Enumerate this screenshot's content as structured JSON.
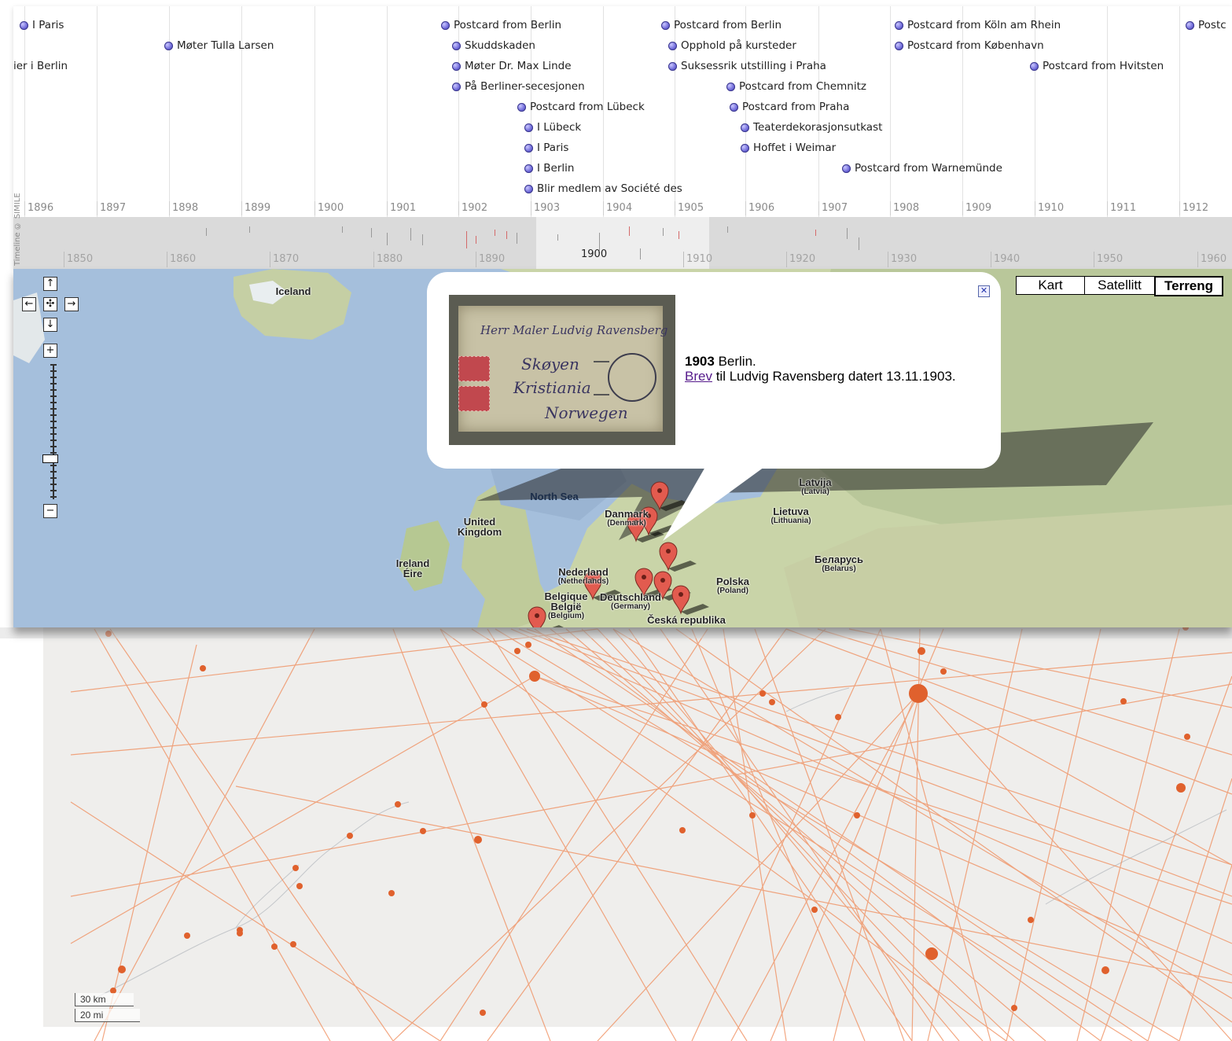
{
  "timeline": {
    "credit": "Timeline © SIMILE",
    "years": [
      "1896",
      "1897",
      "1898",
      "1899",
      "1900",
      "1901",
      "1902",
      "1903",
      "1904",
      "1905",
      "1906",
      "1907",
      "1908",
      "1909",
      "1910",
      "1911",
      "1912"
    ],
    "decades": [
      "1850",
      "1860",
      "1870",
      "1880",
      "1890",
      "1900",
      "1910",
      "1920",
      "1930",
      "1940",
      "1950",
      "1960"
    ],
    "center_label": "1900",
    "events": [
      {
        "label": "I Paris"
      },
      {
        "label": "Møter Tulla Larsen"
      },
      {
        "label": "ier i Berlin"
      },
      {
        "label": "Postcard from Berlin"
      },
      {
        "label": "Skuddskaden"
      },
      {
        "label": "Møter Dr. Max Linde"
      },
      {
        "label": "På Berliner-secesjonen"
      },
      {
        "label": "Postcard from Lübeck"
      },
      {
        "label": "I Lübeck"
      },
      {
        "label": "I Paris"
      },
      {
        "label": "I Berlin"
      },
      {
        "label": "Blir medlem av Société des"
      },
      {
        "label": "Postcard from Berlin"
      },
      {
        "label": "Opphold på kursteder"
      },
      {
        "label": "Suksessrik utstilling i Praha"
      },
      {
        "label": "Postcard from Chemnitz"
      },
      {
        "label": "Postcard from Praha"
      },
      {
        "label": "Teaterdekorasjonsutkast"
      },
      {
        "label": "Hoffet i Weimar"
      },
      {
        "label": "Postcard from Warnemünde"
      },
      {
        "label": "Postcard from Köln am Rhein"
      },
      {
        "label": "Postcard from København"
      },
      {
        "label": "Postcard from Hvitsten"
      },
      {
        "label": "Postc"
      }
    ]
  },
  "map": {
    "map_types": [
      "Kart",
      "Satellitt",
      "Terreng"
    ],
    "active_map_type": "Terreng",
    "nav": {
      "up": "↑",
      "left": "←",
      "center": "✣",
      "right": "→",
      "down": "↓",
      "zoom_in": "+",
      "zoom_out": "−"
    },
    "labels": {
      "iceland": "Iceland",
      "north_sea": "North Sea",
      "denmark": "Danmark",
      "denmark_sub": "(Denmark)",
      "uk": "United\nKingdom",
      "ireland": "Ireland\nÉire",
      "netherlands": "Nederland",
      "netherlands_sub": "(Netherlands)",
      "belgium": "Belgique\nBelgië",
      "belgium_sub": "(Belgium)",
      "germany": "Deutschland",
      "germany_sub": "(Germany)",
      "czech": "Česká republika",
      "poland": "Polska",
      "poland_sub": "(Poland)",
      "latvia": "Latvija",
      "latvia_sub": "(Latvia)",
      "lithuania": "Lietuva",
      "lithuania_sub": "(Lithuania)",
      "belarus": "Беларусь",
      "belarus_sub": "(Belarus)"
    },
    "popup": {
      "year": "1903",
      "place": "Berlin.",
      "link_text": "Brev",
      "description": "til Ludvig Ravensberg datert 13.11.1903.",
      "close_icon": "close-icon",
      "image_handwriting": [
        "Herr Maler Ludvig Ravensberg",
        "Skøyen",
        "Kristiania",
        "Norwegen"
      ]
    }
  },
  "scale": {
    "km": "30 km",
    "mi": "20 mi"
  },
  "colors": {
    "route": "#e8733a",
    "accent_marker": "#e25b4f",
    "event_dot": "#6d68d8"
  }
}
